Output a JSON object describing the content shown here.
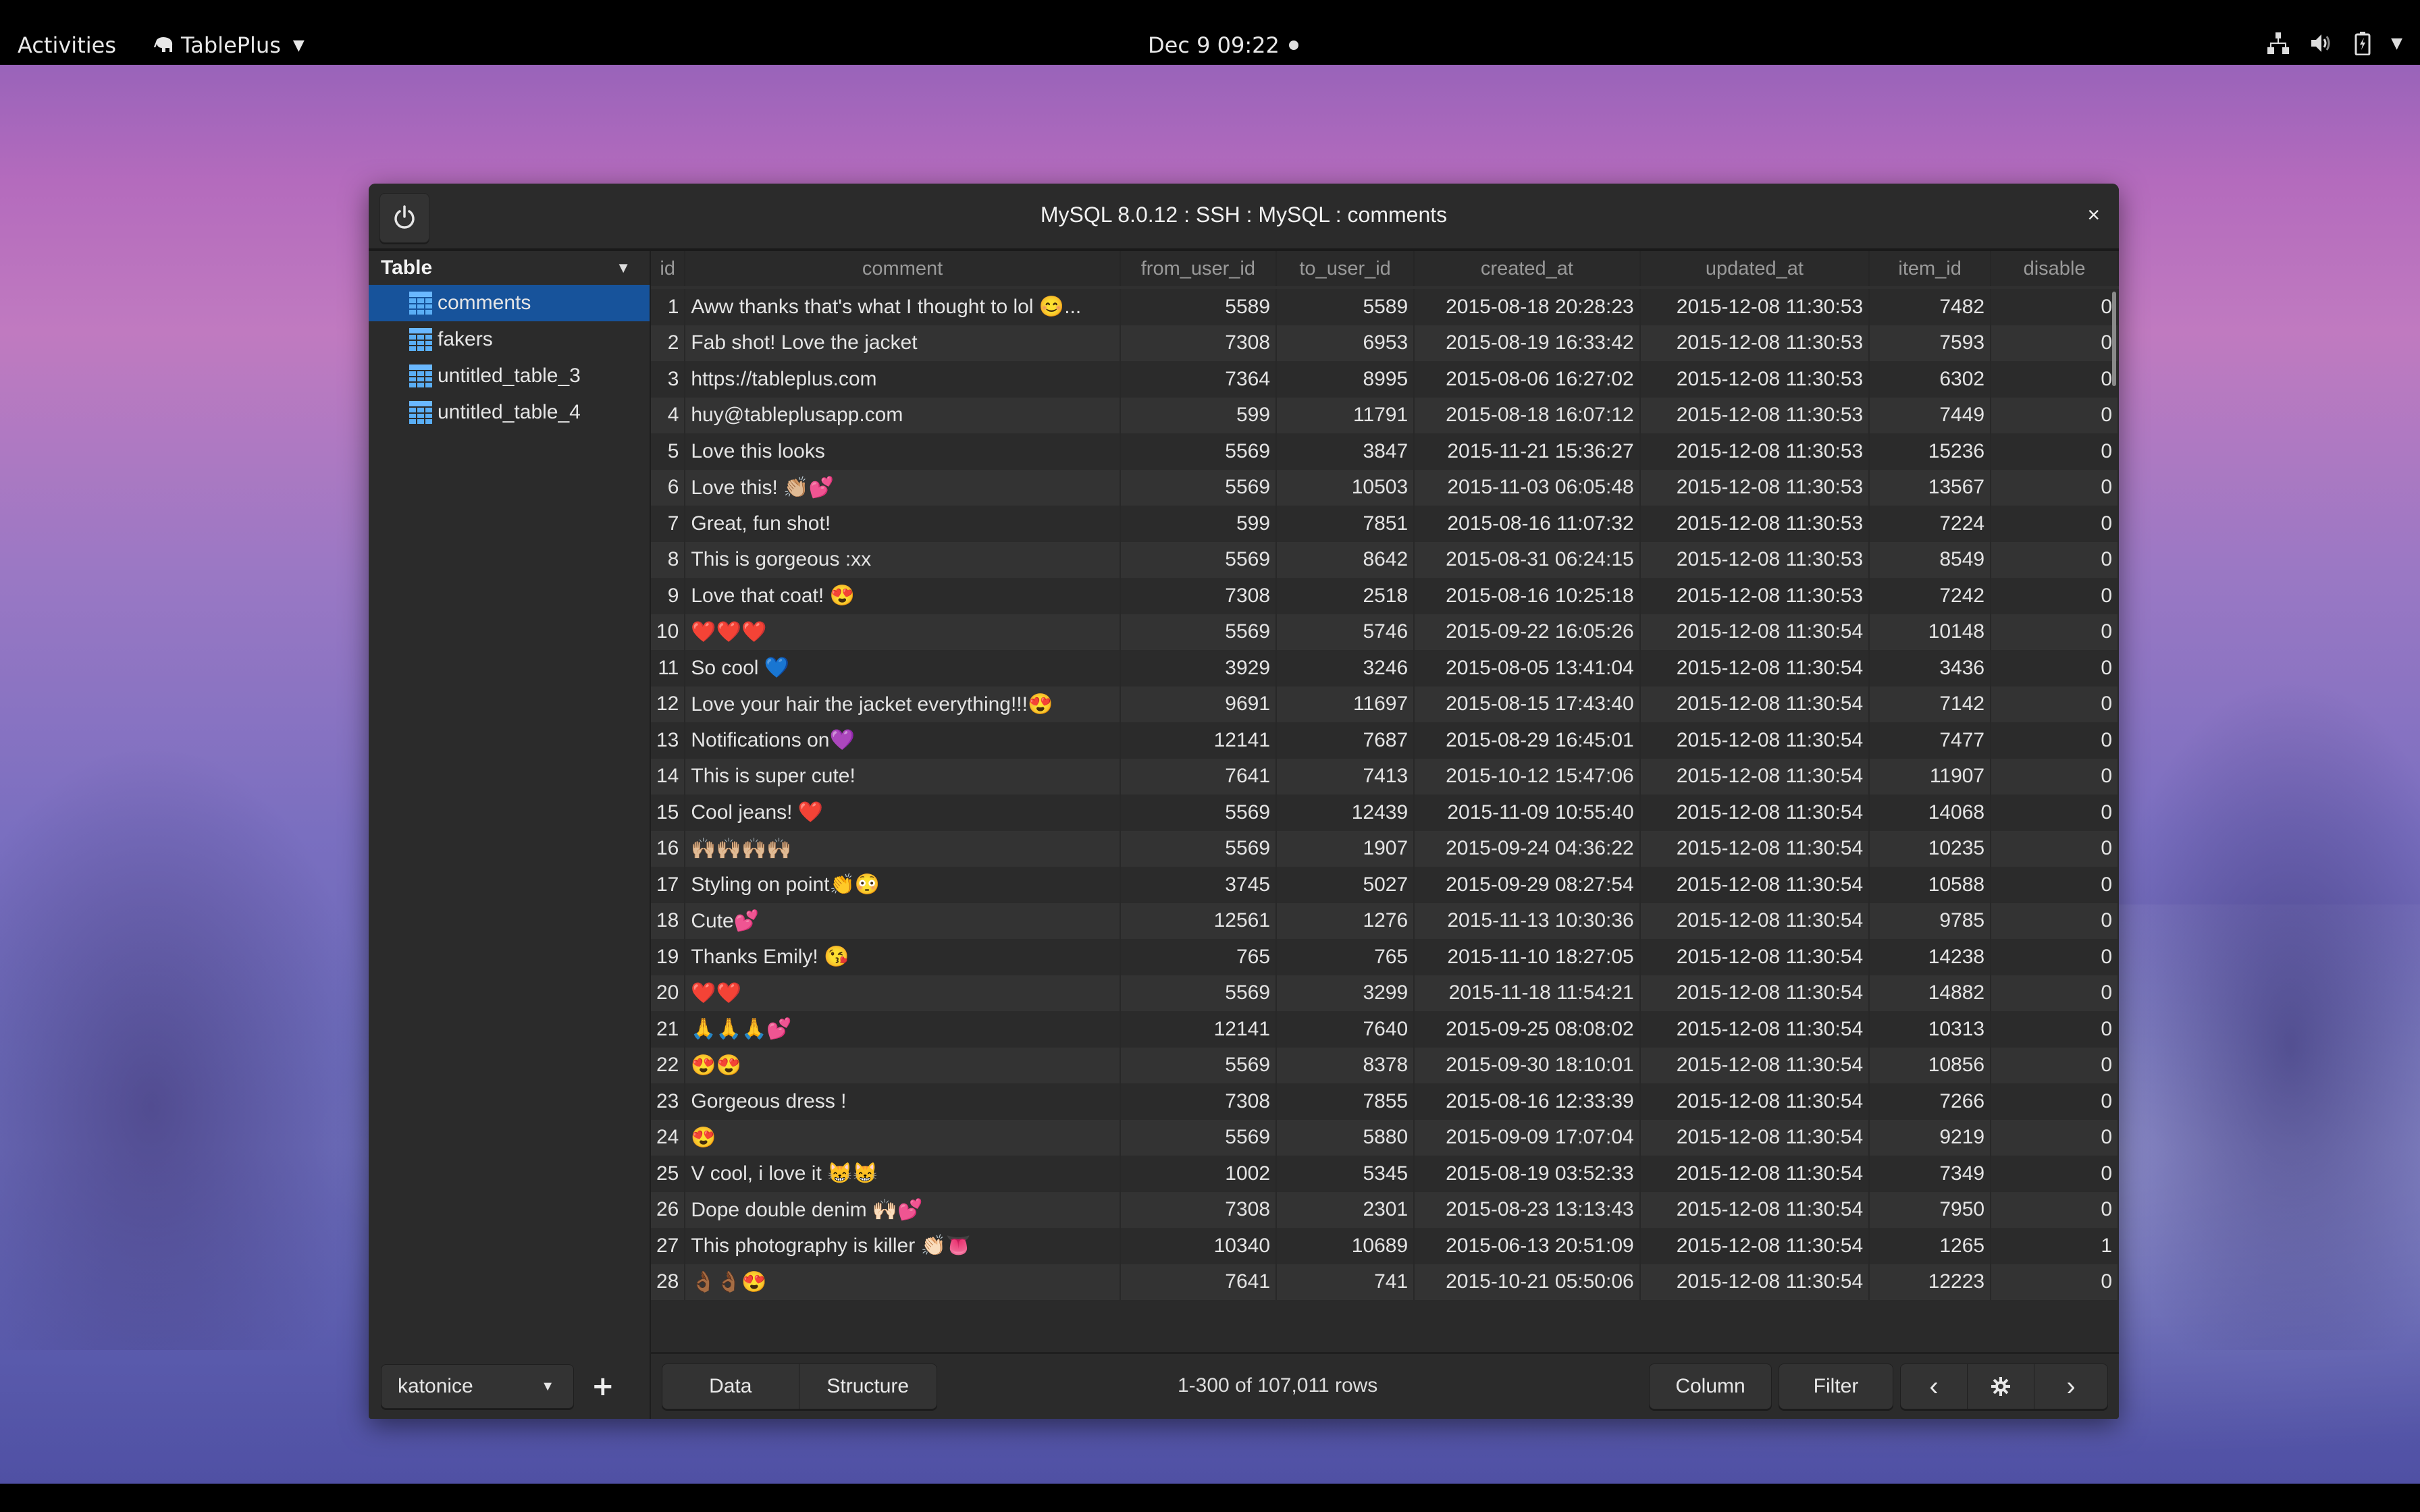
{
  "topbar": {
    "activities": "Activities",
    "app_name": "TablePlus",
    "clock": "Dec 9  09:22",
    "tray_icons": [
      "network-icon",
      "volume-icon",
      "battery-icon",
      "system-menu-caret"
    ]
  },
  "window": {
    "title": "MySQL 8.0.12 : SSH : MySQL : comments",
    "close_label": "×"
  },
  "sidebar": {
    "header": "Table",
    "tables": [
      {
        "name": "comments",
        "active": true
      },
      {
        "name": "fakers",
        "active": false
      },
      {
        "name": "untitled_table_3",
        "active": false
      },
      {
        "name": "untitled_table_4",
        "active": false
      }
    ],
    "database": "katonice",
    "add_label": "+"
  },
  "grid": {
    "columns": [
      "id",
      "comment",
      "from_user_id",
      "to_user_id",
      "created_at",
      "updated_at",
      "item_id",
      "disable"
    ],
    "rows": [
      [
        "1",
        "Aww thanks that's what I thought to lol 😊...",
        "5589",
        "5589",
        "2015-08-18 20:28:23",
        "2015-12-08 11:30:53",
        "7482",
        "0"
      ],
      [
        "2",
        "Fab shot! Love the jacket",
        "7308",
        "6953",
        "2015-08-19 16:33:42",
        "2015-12-08 11:30:53",
        "7593",
        "0"
      ],
      [
        "3",
        "https://tableplus.com",
        "7364",
        "8995",
        "2015-08-06 16:27:02",
        "2015-12-08 11:30:53",
        "6302",
        "0"
      ],
      [
        "4",
        "huy@tableplusapp.com",
        "599",
        "11791",
        "2015-08-18 16:07:12",
        "2015-12-08 11:30:53",
        "7449",
        "0"
      ],
      [
        "5",
        "Love this looks",
        "5569",
        "3847",
        "2015-11-21 15:36:27",
        "2015-12-08 11:30:53",
        "15236",
        "0"
      ],
      [
        "6",
        "Love this! 👏🏼💕",
        "5569",
        "10503",
        "2015-11-03 06:05:48",
        "2015-12-08 11:30:53",
        "13567",
        "0"
      ],
      [
        "7",
        "Great, fun shot!",
        "599",
        "7851",
        "2015-08-16 11:07:32",
        "2015-12-08 11:30:53",
        "7224",
        "0"
      ],
      [
        "8",
        "This is gorgeous :xx",
        "5569",
        "8642",
        "2015-08-31 06:24:15",
        "2015-12-08 11:30:53",
        "8549",
        "0"
      ],
      [
        "9",
        "Love that coat! 😍",
        "7308",
        "2518",
        "2015-08-16 10:25:18",
        "2015-12-08 11:30:53",
        "7242",
        "0"
      ],
      [
        "10",
        "❤️❤️❤️",
        "5569",
        "5746",
        "2015-09-22 16:05:26",
        "2015-12-08 11:30:54",
        "10148",
        "0"
      ],
      [
        "11",
        "So cool 💙",
        "3929",
        "3246",
        "2015-08-05 13:41:04",
        "2015-12-08 11:30:54",
        "3436",
        "0"
      ],
      [
        "12",
        "Love your hair the jacket everything!!!😍",
        "9691",
        "11697",
        "2015-08-15 17:43:40",
        "2015-12-08 11:30:54",
        "7142",
        "0"
      ],
      [
        "13",
        "Notifications on💜",
        "12141",
        "7687",
        "2015-08-29 16:45:01",
        "2015-12-08 11:30:54",
        "7477",
        "0"
      ],
      [
        "14",
        "This is super cute!",
        "7641",
        "7413",
        "2015-10-12 15:47:06",
        "2015-12-08 11:30:54",
        "11907",
        "0"
      ],
      [
        "15",
        "Cool jeans! ❤️",
        "5569",
        "12439",
        "2015-11-09 10:55:40",
        "2015-12-08 11:30:54",
        "14068",
        "0"
      ],
      [
        "16",
        "🙌🏼🙌🏼🙌🏼🙌🏼",
        "5569",
        "1907",
        "2015-09-24 04:36:22",
        "2015-12-08 11:30:54",
        "10235",
        "0"
      ],
      [
        "17",
        "Styling on point👏😳",
        "3745",
        "5027",
        "2015-09-29 08:27:54",
        "2015-12-08 11:30:54",
        "10588",
        "0"
      ],
      [
        "18",
        "Cute💕",
        "12561",
        "1276",
        "2015-11-13 10:30:36",
        "2015-12-08 11:30:54",
        "9785",
        "0"
      ],
      [
        "19",
        "Thanks Emily! 😘",
        "765",
        "765",
        "2015-11-10 18:27:05",
        "2015-12-08 11:30:54",
        "14238",
        "0"
      ],
      [
        "20",
        "❤️❤️",
        "5569",
        "3299",
        "2015-11-18 11:54:21",
        "2015-12-08 11:30:54",
        "14882",
        "0"
      ],
      [
        "21",
        "🙏🙏🙏💕",
        "12141",
        "7640",
        "2015-09-25 08:08:02",
        "2015-12-08 11:30:54",
        "10313",
        "0"
      ],
      [
        "22",
        "😍😍",
        "5569",
        "8378",
        "2015-09-30 18:10:01",
        "2015-12-08 11:30:54",
        "10856",
        "0"
      ],
      [
        "23",
        "Gorgeous dress !",
        "7308",
        "7855",
        "2015-08-16 12:33:39",
        "2015-12-08 11:30:54",
        "7266",
        "0"
      ],
      [
        "24",
        "😍",
        "5569",
        "5880",
        "2015-09-09 17:07:04",
        "2015-12-08 11:30:54",
        "9219",
        "0"
      ],
      [
        "25",
        "V cool, i love it 😸😸",
        "1002",
        "5345",
        "2015-08-19 03:52:33",
        "2015-12-08 11:30:54",
        "7349",
        "0"
      ],
      [
        "26",
        "Dope double denim 🙌🏻💕",
        "7308",
        "2301",
        "2015-08-23 13:13:43",
        "2015-12-08 11:30:54",
        "7950",
        "0"
      ],
      [
        "27",
        "This photography is killer 👏🏻👅",
        "10340",
        "10689",
        "2015-06-13 20:51:09",
        "2015-12-08 11:30:54",
        "1265",
        "1"
      ],
      [
        "28",
        "👌🏾👌🏾😍",
        "7641",
        "741",
        "2015-10-21 05:50:06",
        "2015-12-08 11:30:54",
        "12223",
        "0"
      ]
    ]
  },
  "toolbar": {
    "data_tab": "Data",
    "structure_tab": "Structure",
    "row_count": "1-300 of 107,011 rows",
    "column_button": "Column",
    "filter_button": "Filter",
    "prev_label": "‹",
    "next_label": "›"
  },
  "colors": {
    "selection": "#17539b",
    "table_icon": "#5aaef5",
    "window_bg": "#2b2b2b"
  }
}
